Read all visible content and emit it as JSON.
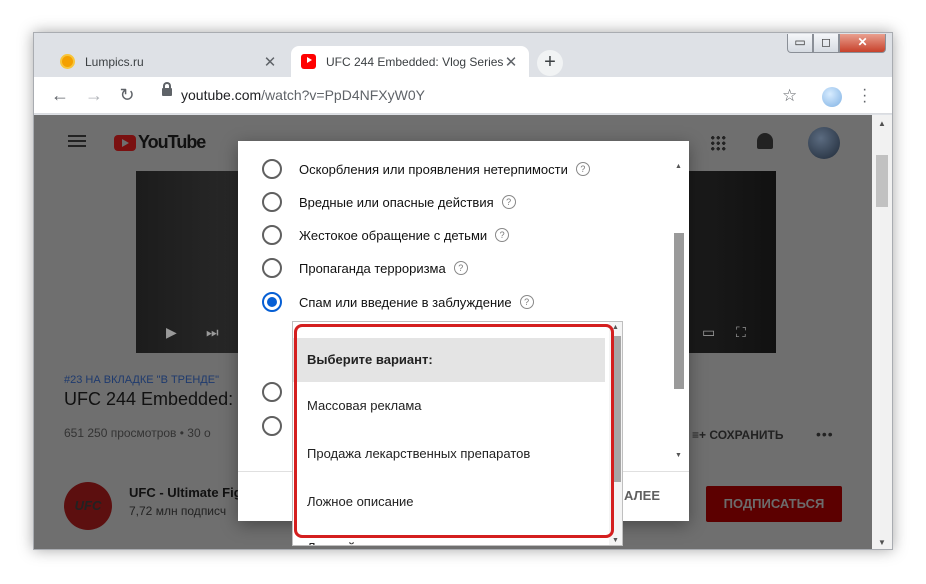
{
  "browser": {
    "tabs": [
      {
        "label": "Lumpics.ru",
        "icon": "lumpics-favicon"
      },
      {
        "label": "UFC 244 Embedded: Vlog Series",
        "icon": "youtube-favicon"
      }
    ],
    "url_domain": "youtube.com",
    "url_path": "/watch?v=PpD4NFXyW0Y",
    "window_buttons": {
      "minimize": "▭",
      "maximize": "◻",
      "close": "✕"
    }
  },
  "youtube": {
    "logo_text": "YouTube",
    "trending": "#23 НА ВКЛАДКЕ \"В ТРЕНДЕ\"",
    "video_title": "UFC 244 Embedded: V",
    "views": "651 250 просмотров • 30 о",
    "save_label": "СОХРАНИТЬ",
    "channel_name": "UFC - Ultimate Fig",
    "channel_subs": "7,72 млн подписч",
    "channel_avatar_text": "UFC",
    "subscribe_label": "ПОДПИСАТЬСЯ"
  },
  "dialog": {
    "options": [
      {
        "label": "Оскорбления или проявления нетерпимости",
        "selected": false
      },
      {
        "label": "Вредные или опасные действия",
        "selected": false
      },
      {
        "label": "Жестокое обращение с детьми",
        "selected": false
      },
      {
        "label": "Пропаганда терроризма",
        "selected": false
      },
      {
        "label": "Спам или введение в заблуждение",
        "selected": true
      }
    ],
    "next_label": "АЛЕЕ"
  },
  "dropdown": {
    "items": [
      "Выберите вариант:",
      "Массовая реклама",
      "Продажа лекарственных препаратов",
      "Ложное описание",
      "Ложный значок видео"
    ],
    "selected_index": 0
  },
  "colors": {
    "highlight": "#d41f1f",
    "radio_selected": "#065fd4"
  }
}
